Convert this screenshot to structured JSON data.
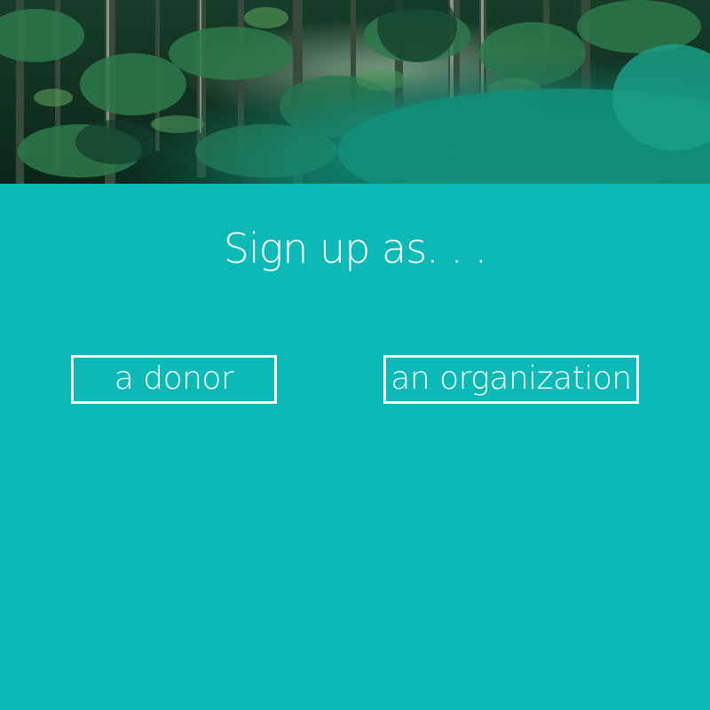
{
  "hero": {
    "image": "rainforest-photo",
    "colors": {
      "dark": "#0e2a1c",
      "leaf": "#1f6b4a",
      "teal_haze": "#138c77"
    }
  },
  "signup": {
    "title": "Sign up as. . .",
    "options": [
      {
        "label": "a donor"
      },
      {
        "label": "an organization"
      }
    ]
  },
  "theme": {
    "background": "#0bbab6",
    "text": "#ffffff"
  }
}
